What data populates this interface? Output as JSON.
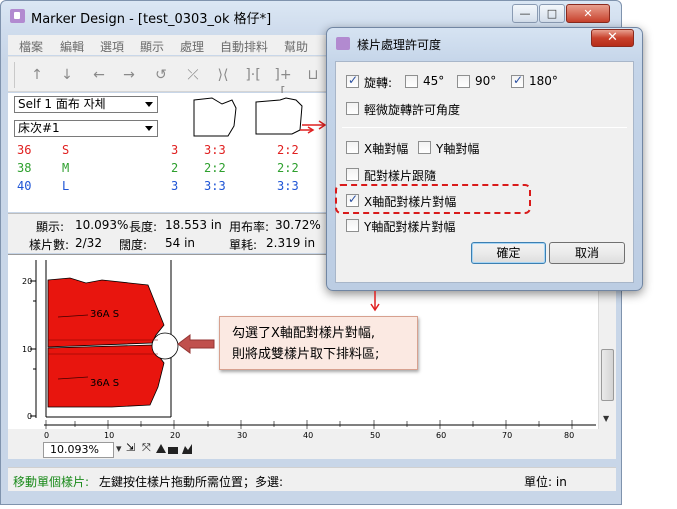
{
  "window": {
    "title": "Marker Design - [test_0303_ok 格仔*]",
    "buttons": {
      "minimize": "—",
      "maximize": "□",
      "close": "✕"
    }
  },
  "menu": [
    "檔案",
    "編輯",
    "選項",
    "顯示",
    "處理",
    "自動排料",
    "幫助"
  ],
  "toolbar_icons": [
    "arrow-up-icon",
    "arrow-down-icon",
    "arrow-left-icon",
    "arrow-right-icon",
    "rotate-icon",
    "flip-vertical-icon",
    "flip-horizontal-icon",
    "bracket-icon",
    "bracket-plus-icon",
    "bracket-fold-icon"
  ],
  "selectors": {
    "fabric": "Self 1 面布 자체",
    "bed": "床次#1"
  },
  "size_rows": [
    {
      "code": "36",
      "size": "S",
      "a": "3",
      "b": "3:3",
      "c": "2:2",
      "color": "#e02020"
    },
    {
      "code": "38",
      "size": "M",
      "a": "2",
      "b": "2:2",
      "c": "2:2",
      "color": "#2ea02e"
    },
    {
      "code": "40",
      "size": "L",
      "a": "3",
      "b": "3:3",
      "c": "3:3",
      "color": "#1f55d6"
    }
  ],
  "stats": {
    "display_label": "顯示:",
    "display_value": "10.093%",
    "length_label": "長度:",
    "length_value": "18.553 in",
    "usage_label": "用布率:",
    "usage_value": "30.72%",
    "pieces_label": "樣片數:",
    "pieces_value": "2/32",
    "width_label": "闊度:",
    "width_value": "54 in",
    "consumption_label": "單耗:",
    "consumption_value": "2.319 in"
  },
  "canvas": {
    "ruler_v": [
      "20",
      "10",
      "0"
    ],
    "ruler_h": [
      "0",
      "10",
      "20",
      "30",
      "40",
      "50",
      "60",
      "70",
      "80",
      "90",
      "100",
      "110",
      "120",
      "130",
      "140"
    ],
    "piece_label_top": "36A S",
    "piece_label_bottom": "36A S",
    "piece_color": "#e8150e"
  },
  "zoom": {
    "value": "10.093%"
  },
  "statusbar": {
    "hint_label": "移動單個樣片:",
    "hint_text": "左鍵按住樣片拖動所需位置；多選:",
    "unit": "單位: in"
  },
  "dialog": {
    "title": "樣片處理許可度",
    "close": "✕",
    "rotate_label": "旋轉:",
    "rotate_checked": true,
    "deg45": "45°",
    "deg45_checked": false,
    "deg90": "90°",
    "deg90_checked": false,
    "deg180": "180°",
    "deg180_checked": true,
    "slight_rotate": "輕微旋轉許可角度",
    "slight_rotate_checked": false,
    "x_align": "X軸對幅",
    "x_align_checked": false,
    "y_align": "Y軸對幅",
    "y_align_checked": false,
    "pair_follow": "配對樣片跟隨",
    "pair_follow_checked": false,
    "x_pair_align": "X軸配對樣片對幅",
    "x_pair_align_checked": true,
    "y_pair_align": "Y軸配對樣片對幅",
    "y_pair_align_checked": false,
    "ok": "確定",
    "cancel": "取消"
  },
  "callout": {
    "line1": "勾選了X軸配對樣片對幅,",
    "line2": "則將成雙樣片取下排料區;"
  }
}
